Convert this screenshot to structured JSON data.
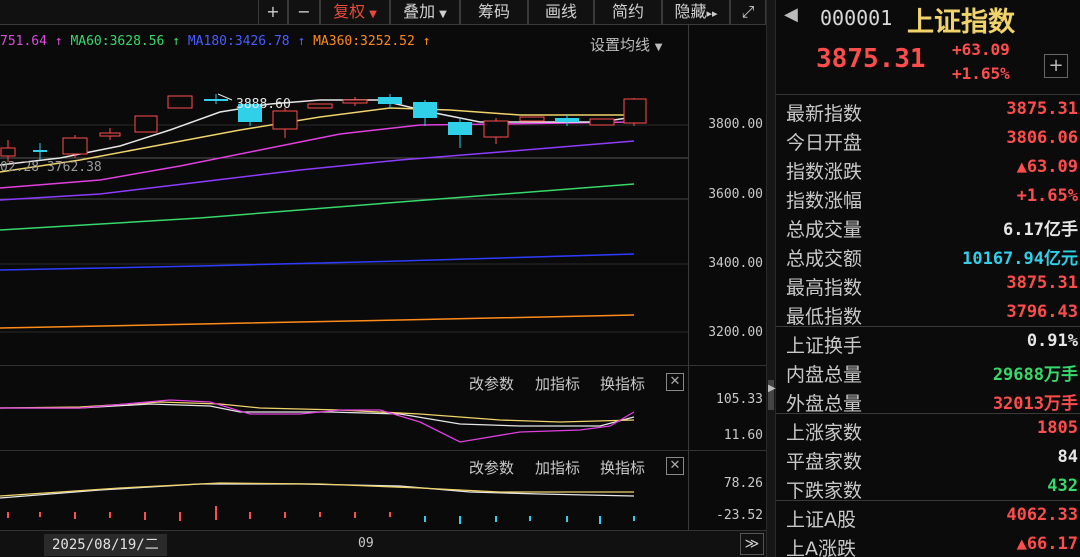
{
  "toolbar": {
    "plus": "+",
    "minus": "−",
    "restore_rights": "复权",
    "overlay": "叠加",
    "chips": "筹码",
    "draw_line": "画线",
    "brief": "简约",
    "hide": "隐藏",
    "double_arrow": "▸▸",
    "expand": "⤢"
  },
  "ma_legend": {
    "ma30": "751.64",
    "ma60": "MA60:3628.56",
    "ma180": "MA180:3426.78",
    "ma360": "MA360:3252.52",
    "set_ma": "设置均线"
  },
  "chart_annotations": {
    "high_label": "3888.60",
    "low_label": "02.28 3762.38"
  },
  "price_axis": [
    "3800.00",
    "3600.00",
    "3400.00",
    "3200.00"
  ],
  "indicator1": {
    "change_params": "改参数",
    "add_indicator": "加指标",
    "switch_indicator": "换指标",
    "close": "✕",
    "axis": [
      "105.33",
      "11.60"
    ]
  },
  "indicator2": {
    "change_params": "改参数",
    "add_indicator": "加指标",
    "switch_indicator": "换指标",
    "close": "✕",
    "axis": [
      "78.26",
      "-23.52"
    ]
  },
  "x_axis": {
    "date": "2025/08/19/二",
    "month": "09",
    "nav": "≫"
  },
  "quote": {
    "code": "000001",
    "name": "上证指数",
    "price": "3875.31",
    "change": "+63.09",
    "change_pct": "+1.65%",
    "add": "+"
  },
  "stats": [
    {
      "label": "最新指数",
      "value": "3875.31",
      "color": "#ff4d4d"
    },
    {
      "label": "今日开盘",
      "value": "3806.06",
      "color": "#ff4d4d"
    },
    {
      "label": "指数涨跌",
      "value": "▲63.09",
      "color": "#ff4d4d"
    },
    {
      "label": "指数涨幅",
      "value": "+1.65%",
      "color": "#ff4d4d"
    },
    {
      "label": "总成交量",
      "value": "6.17亿手",
      "color": "#e6e6e6"
    },
    {
      "label": "总成交额",
      "value": "10167.94亿元",
      "color": "#2fd0e8"
    },
    {
      "label": "最高指数",
      "value": "3875.31",
      "color": "#ff4d4d"
    },
    {
      "label": "最低指数",
      "value": "3796.43",
      "color": "#ff4d4d"
    },
    {
      "label": "上证换手",
      "value": "0.91%",
      "color": "#e6e6e6"
    },
    {
      "label": "内盘总量",
      "value": "29688万手",
      "color": "#36d96b"
    },
    {
      "label": "外盘总量",
      "value": "32013万手",
      "color": "#ff4d4d"
    },
    {
      "label": "上涨家数",
      "value": "1805",
      "color": "#ff4d4d"
    },
    {
      "label": "平盘家数",
      "value": "84",
      "color": "#e6e6e6"
    },
    {
      "label": "下跌家数",
      "value": "432",
      "color": "#36d96b"
    },
    {
      "label": "上证A股",
      "value": "4062.33",
      "color": "#ff4d4d"
    },
    {
      "label": "上A涨跌",
      "value": "▲66.17",
      "color": "#ff4d4d"
    }
  ],
  "colors": {
    "up": "#ff4d4d",
    "down": "#36d96b",
    "accent": "#e8493c",
    "cyan": "#2fd0e8",
    "gold": "#f0d36b"
  }
}
